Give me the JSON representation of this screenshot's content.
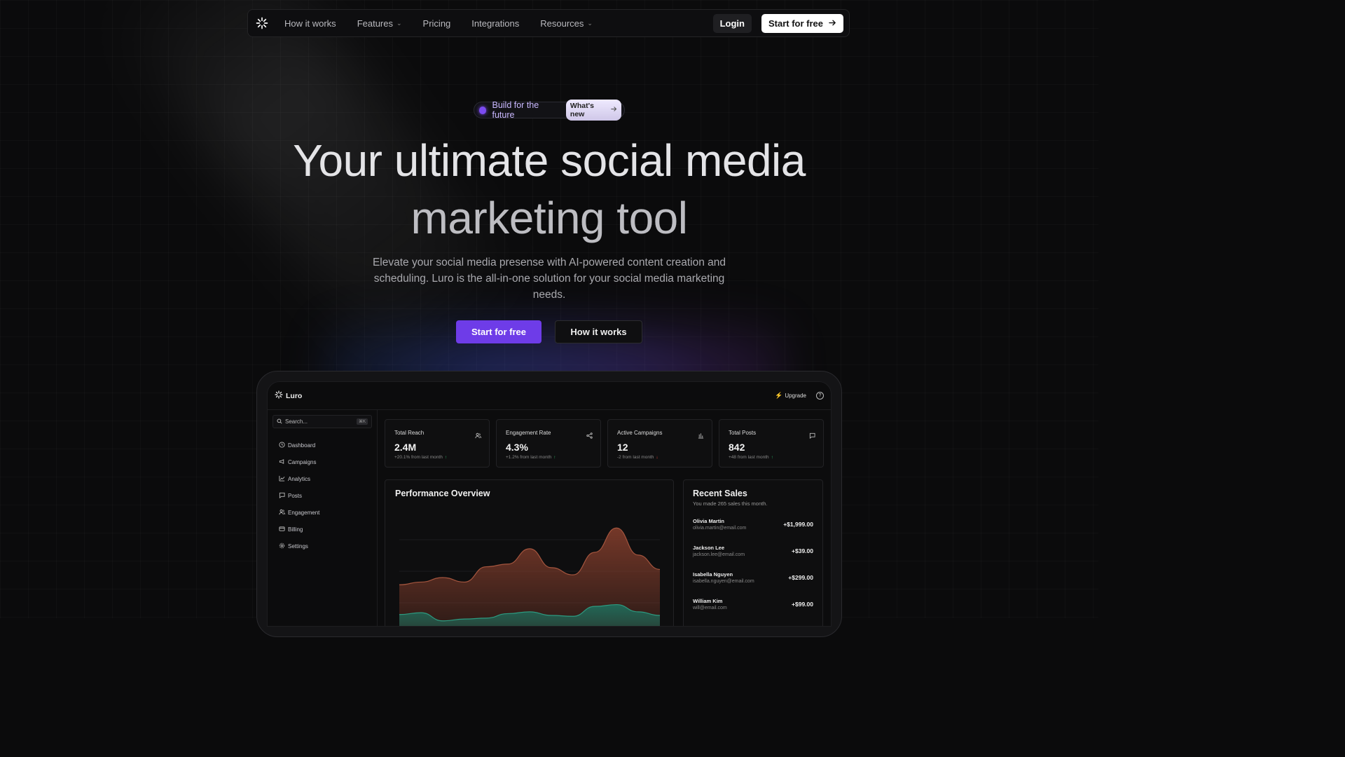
{
  "nav": {
    "links": [
      {
        "label": "How it works",
        "dropdown": false
      },
      {
        "label": "Features",
        "dropdown": true
      },
      {
        "label": "Pricing",
        "dropdown": false
      },
      {
        "label": "Integrations",
        "dropdown": false
      },
      {
        "label": "Resources",
        "dropdown": true
      }
    ],
    "login_label": "Login",
    "start_label": "Start for free"
  },
  "hero": {
    "pill_text": "Build for the future",
    "pill_badge": "What's new",
    "headline_line1": "Your ultimate social media",
    "headline_line2": "marketing tool",
    "subtext": "Elevate your social media presense with AI-powered content creation and scheduling. Luro is the all-in-one solution for your social media marketing needs.",
    "cta_primary": "Start for free",
    "cta_secondary": "How it works"
  },
  "colors": {
    "accent": "#6e3ce8",
    "up": "#2bbf6a",
    "down": "#e0443b",
    "area_red": "#7a3a2a",
    "area_teal": "#1f6b5a"
  },
  "dashboard": {
    "brand": "Luro",
    "upgrade": "Upgrade",
    "search_placeholder": "Search...",
    "search_kbd": "⌘K",
    "sidebar": [
      {
        "label": "Dashboard",
        "icon": "clock-icon"
      },
      {
        "label": "Campaigns",
        "icon": "megaphone-icon"
      },
      {
        "label": "Analytics",
        "icon": "line-chart-icon"
      },
      {
        "label": "Posts",
        "icon": "message-square-icon"
      },
      {
        "label": "Engagement",
        "icon": "users-icon"
      },
      {
        "label": "Billing",
        "icon": "credit-card-icon"
      },
      {
        "label": "Settings",
        "icon": "gear-icon"
      }
    ],
    "stats": [
      {
        "title": "Total Reach",
        "value": "2.4M",
        "change": "+20.1% from last month",
        "trend": "up",
        "icon": "users-icon"
      },
      {
        "title": "Engagement Rate",
        "value": "4.3%",
        "change": "+1.2% from last month",
        "trend": "up",
        "icon": "share-icon"
      },
      {
        "title": "Active Campaigns",
        "value": "12",
        "change": "-2 from last month",
        "trend": "down",
        "icon": "bar-chart-icon"
      },
      {
        "title": "Total Posts",
        "value": "842",
        "change": "+48 from last month",
        "trend": "up",
        "icon": "message-square-icon"
      }
    ],
    "performance_title": "Performance Overview",
    "sales_title": "Recent Sales",
    "sales_sub": "You made 265 sales this month.",
    "sales": [
      {
        "name": "Olivia Martin",
        "email": "olivia.martin@email.com",
        "amount": "+$1,999.00"
      },
      {
        "name": "Jackson Lee",
        "email": "jackson.lee@email.com",
        "amount": "+$39.00"
      },
      {
        "name": "Isabella Nguyen",
        "email": "isabella.nguyen@email.com",
        "amount": "+$299.00"
      },
      {
        "name": "William Kim",
        "email": "will@email.com",
        "amount": "+$99.00"
      }
    ]
  },
  "chart_data": {
    "type": "area",
    "x": [
      0,
      1,
      2,
      3,
      4,
      5,
      6,
      7,
      8,
      9,
      10,
      11,
      12
    ],
    "series": [
      {
        "values": [
          55,
          58,
          63,
          58,
          75,
          78,
          95,
          74,
          66,
          91,
          118,
          88,
          72
        ]
      },
      {
        "values": [
          22,
          24,
          15,
          17,
          18,
          23,
          25,
          21,
          20,
          31,
          33,
          25,
          21
        ]
      }
    ],
    "ylim": [
      0,
      140
    ]
  }
}
